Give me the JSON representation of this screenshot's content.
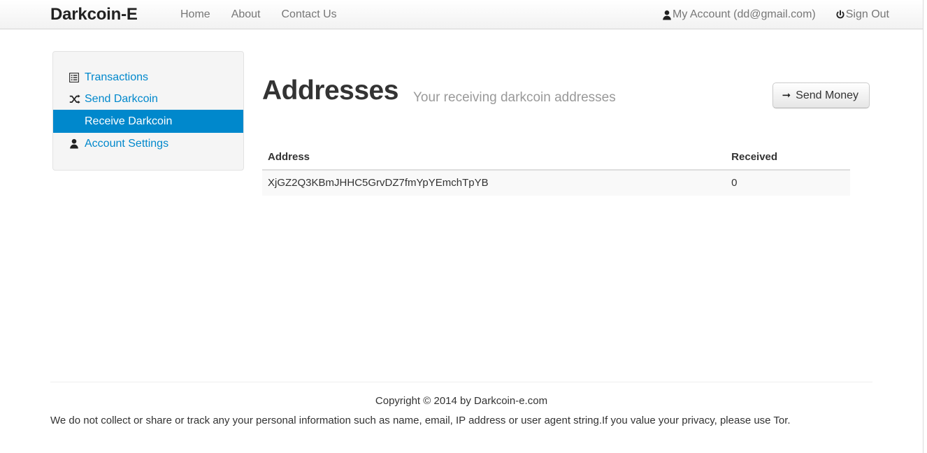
{
  "navbar": {
    "brand": "Darkcoin-E",
    "links": [
      {
        "label": "Home",
        "name": "nav-home"
      },
      {
        "label": "About",
        "name": "nav-about"
      },
      {
        "label": "Contact Us",
        "name": "nav-contact-us"
      }
    ],
    "account_label": "My Account (dd@gmail.com)",
    "account_icon": "user-icon",
    "signout_label": "Sign Out",
    "signout_icon": "power-icon"
  },
  "sidebar": {
    "items": [
      {
        "label": "Transactions",
        "icon": "list-icon",
        "active": false
      },
      {
        "label": "Send Darkcoin",
        "icon": "shuffle-icon",
        "active": false
      },
      {
        "label": "Receive Darkcoin",
        "icon": "",
        "active": true
      },
      {
        "label": "Account Settings",
        "icon": "user-icon",
        "active": false
      }
    ]
  },
  "main": {
    "title": "Addresses",
    "subtitle": "Your receiving darkcoin addresses",
    "send_money_label": "Send Money",
    "send_money_icon": "arrow-right-icon",
    "table": {
      "headers": [
        "Address",
        "Received"
      ],
      "rows": [
        {
          "address": "XjGZ2Q3KBmJHHC5GrvDZ7fmYpYEmchTpYB",
          "received": "0"
        }
      ]
    }
  },
  "footer": {
    "copyright": "Copyright © 2014 by Darkcoin-e.com",
    "privacy": "We do not collect or share or track any your personal information such as name, email, IP address or user agent string.If you value your privacy, please use Tor."
  },
  "colors": {
    "accent_blue": "#0088cc",
    "navbar_bg": "#f2f2f2",
    "sidebar_bg": "#f5f5f5",
    "muted_text": "#999999"
  }
}
